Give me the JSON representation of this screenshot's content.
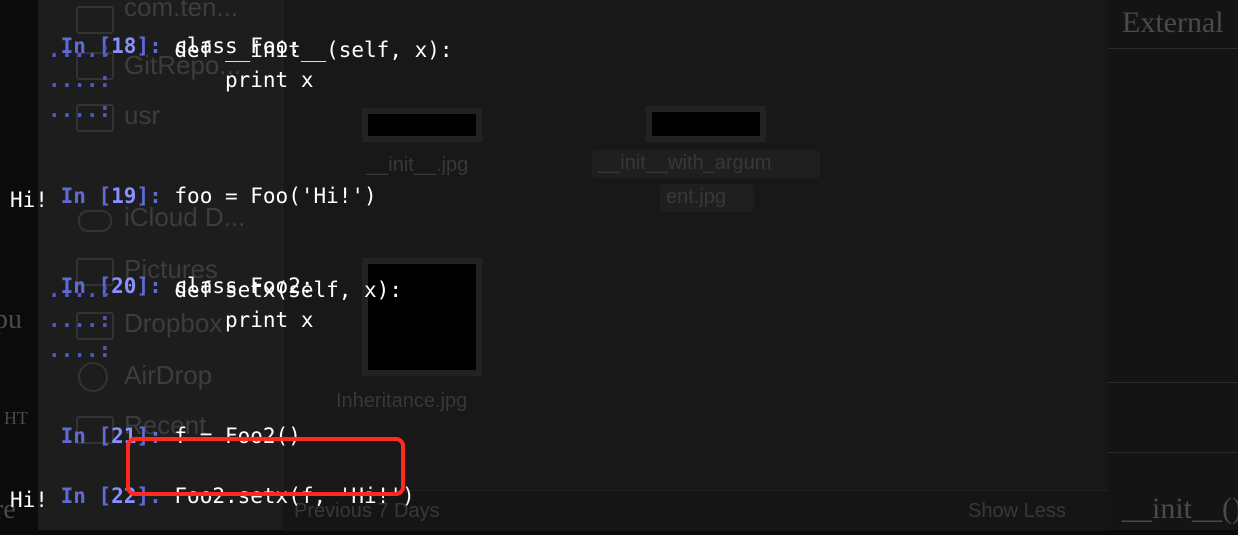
{
  "background": {
    "finder_sidebar_items": [
      "com.ten...",
      "GitRepo...",
      "usr",
      "iCloud D...",
      "Pictures",
      "Dropbox",
      "AirDrop",
      "Recent"
    ],
    "finder_items": [
      {
        "name": "__init__.jpg"
      },
      {
        "name_line1": "__init__with_argum",
        "name_line2": "ent.jpg"
      },
      {
        "name": "Inheritance.jpg"
      }
    ],
    "finder_footer": {
      "left": "Previous 7 Days",
      "right": "Show Less"
    },
    "right_doc": {
      "top": "External",
      "bottom": "__init__()"
    },
    "left_peek": [
      "pu",
      "re",
      "HT"
    ]
  },
  "terminal": {
    "cells": [
      {
        "in": "In [",
        "num": "18",
        "close": "]:",
        "lines": [
          "class Foo:",
          "    def __init__(self, x):",
          "        print x"
        ],
        "cont_count": 3
      },
      {
        "in": "In [",
        "num": "19",
        "close": "]:",
        "lines": [
          "foo = Foo('Hi!')"
        ],
        "output": "Hi!"
      },
      {
        "in": "In [",
        "num": "20",
        "close": "]:",
        "lines": [
          "class Foo2:",
          "    def setx(self, x):",
          "        print x"
        ],
        "cont_count": 3
      },
      {
        "in": "In [",
        "num": "21",
        "close": "]:",
        "lines": [
          "f = Foo2()"
        ]
      },
      {
        "in": "In [",
        "num": "22",
        "close": "]:",
        "lines": [
          "Foo2.setx(f, 'Hi!')"
        ],
        "output": "Hi!"
      }
    ],
    "continuation": "   ....:",
    "colors": {
      "prompt": "#5e6bd8",
      "code": "#ffffff",
      "highlight": "#ff2a1c"
    }
  }
}
